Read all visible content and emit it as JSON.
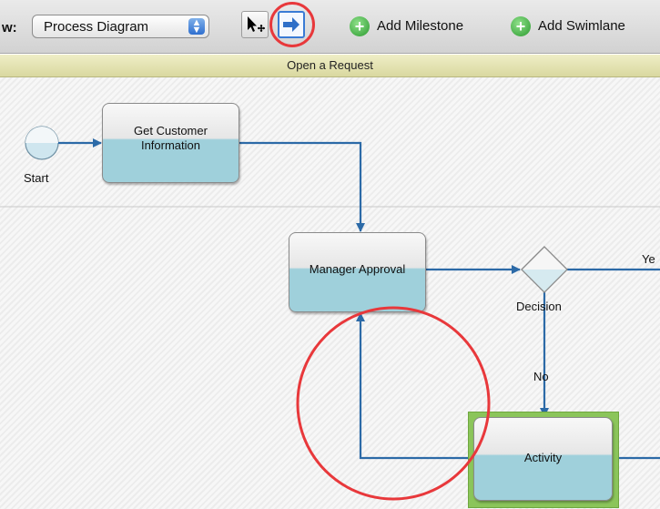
{
  "toolbar": {
    "view_label": "w:",
    "view_select_value": "Process Diagram",
    "add_milestone_label": "Add Milestone",
    "add_swimlane_label": "Add Swimlane"
  },
  "lane": {
    "title": "Open a Request"
  },
  "diagram": {
    "start_label": "Start",
    "task_customer_line1": "Get Customer",
    "task_customer_line2": "Information",
    "task_manager": "Manager Approval",
    "decision_label": "Decision",
    "edge_no": "No",
    "edge_yes": "Ye",
    "task_activity": "Activity"
  },
  "colors": {
    "accent_annotation": "#e8383b",
    "selection_highlight": "#8bc55a",
    "connector": "#2c6aa7",
    "task_fill": "#9fd0db",
    "lane_header": "#e4e3b3"
  }
}
